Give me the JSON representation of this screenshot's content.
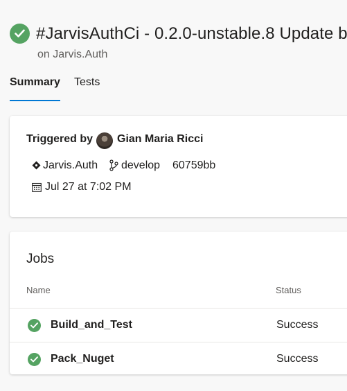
{
  "run": {
    "title": "#JarvisAuthCi - 0.2.0-unstable.8 Update b",
    "subtitle": "on Jarvis.Auth",
    "status": "succeeded",
    "status_color": "#55a362"
  },
  "tabs": [
    {
      "label": "Summary",
      "active": true
    },
    {
      "label": "Tests",
      "active": false
    }
  ],
  "accent_color": "#0078d4",
  "trigger": {
    "label": "Triggered by",
    "user": "Gian Maria Ricci",
    "repo_icon": "repo-diamond-icon",
    "repo": "Jarvis.Auth",
    "branch_icon": "branch-icon",
    "branch": "develop",
    "commit": "60759bb",
    "date_icon": "calendar-icon",
    "date": "Jul 27 at 7:02 PM"
  },
  "jobs": {
    "title": "Jobs",
    "columns": [
      "Name",
      "Status"
    ],
    "rows": [
      {
        "name": "Build_and_Test",
        "status": "Success"
      },
      {
        "name": "Pack_Nuget",
        "status": "Success"
      }
    ]
  }
}
